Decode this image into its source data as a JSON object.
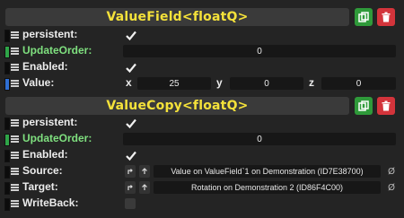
{
  "panels": [
    {
      "title": "ValueField<floatQ>",
      "rows": {
        "persistent": {
          "label": "persistent:"
        },
        "update_order": {
          "label": "UpdateOrder:",
          "value": "0"
        },
        "enabled": {
          "label": "Enabled:"
        },
        "value": {
          "label": "Value:",
          "x_label": "x",
          "x": "25",
          "y_label": "y",
          "y": "0",
          "z_label": "z",
          "z": "0"
        }
      }
    },
    {
      "title": "ValueCopy<floatQ>",
      "rows": {
        "persistent": {
          "label": "persistent:"
        },
        "update_order": {
          "label": "UpdateOrder:",
          "value": "0"
        },
        "enabled": {
          "label": "Enabled:"
        },
        "source": {
          "label": "Source:",
          "value": "Value on ValueField`1 on Demonstration (ID7E38700)",
          "null_glyph": "Ø"
        },
        "target": {
          "label": "Target:",
          "value": "Rotation on Demonstration 2 (ID86F4C00)",
          "null_glyph": "Ø"
        },
        "write_back": {
          "label": "WriteBack:"
        }
      }
    }
  ],
  "icons": {
    "duplicate": "duplicate-icon",
    "delete": "trash-icon",
    "check": "checkmark-icon",
    "grip": "drag-handle-icon",
    "jump": "jump-to-icon",
    "up": "arrow-up-icon"
  },
  "colors": {
    "background": "#242424",
    "header": "#3a3a3a",
    "title": "#f5e23a",
    "field": "#171717",
    "duplicate": "#2f9a3a",
    "delete": "#d3343b",
    "green_label": "#7fe07f"
  }
}
